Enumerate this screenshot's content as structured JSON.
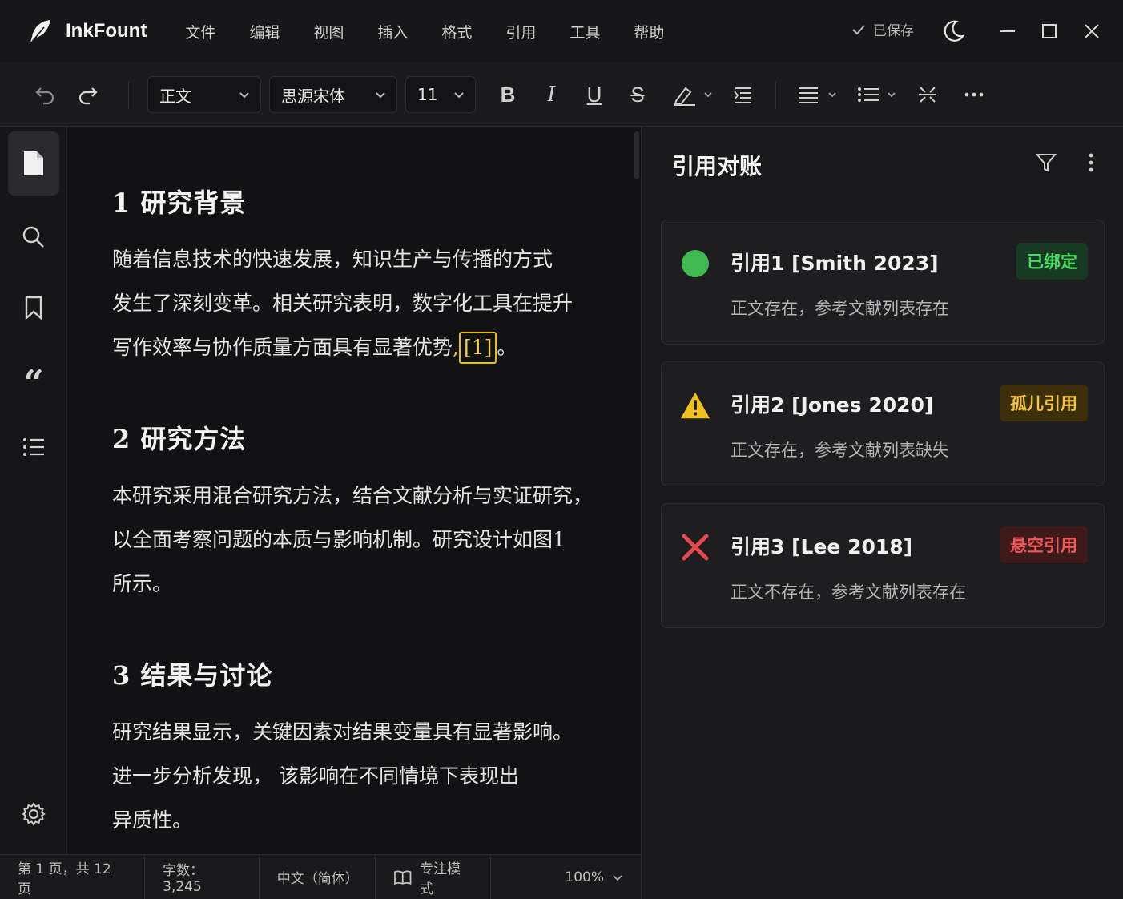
{
  "app": {
    "name": "InkFount",
    "logo": "feather-icon"
  },
  "menu": [
    "文件",
    "编辑",
    "视图",
    "插入",
    "格式",
    "引用",
    "工具",
    "帮助"
  ],
  "save_status": "已保存",
  "toolbar": {
    "style": "正文",
    "font": "思源宋体",
    "size": "11"
  },
  "document": {
    "sections": [
      {
        "heading": "1 研究背景",
        "lines": [
          "随着信息技术的快速发展，知识生产与传播的方式",
          "发生了深刻变革。相关研究表明，数字化工具在提升"
        ],
        "last_line_before_cite": "写作效率与协作质量方面具有显著优势",
        "cite": "[1]",
        "last_line_after_cite": "。"
      },
      {
        "heading": "2 研究方法",
        "lines": [
          "本研究采用混合研究方法，结合文献分析与实证研究，",
          "以全面考察问题的本质与影响机制。研究设计如图1",
          "所示。"
        ]
      },
      {
        "heading": "3 结果与讨论",
        "lines": [
          "研究结果显示，关键因素对结果变量具有显著影响。",
          "进一步分析发现， 该影响在不同情境下表现出",
          "异质性。"
        ]
      }
    ]
  },
  "status_bar": {
    "page": "第 1 页，共 12 页",
    "words": "字数：3,245",
    "language": "中文（简体）",
    "focus": "专注模式",
    "zoom": "100%"
  },
  "panel": {
    "title": "引用对账",
    "cards": [
      {
        "title": "引用1 [Smith 2023]",
        "desc": "正文存在，参考文献列表存在",
        "badge": "已绑定",
        "status": "bound",
        "icon": "green-dot-icon",
        "color": "#3fb950",
        "badge_bg": "#163a22",
        "badge_fg": "#4cd964"
      },
      {
        "title": "引用2 [Jones 2020]",
        "desc": "正文存在，参考文献列表缺失",
        "badge": "孤儿引用",
        "status": "orphan",
        "icon": "warning-icon",
        "color": "#f0c020",
        "badge_bg": "#3d2f0a",
        "badge_fg": "#f5c542"
      },
      {
        "title": "引用3 [Lee 2018]",
        "desc": "正文不存在，参考文献列表存在",
        "badge": "悬空引用",
        "status": "dangling",
        "icon": "x-icon",
        "color": "#e5484d",
        "badge_bg": "#3e1a1b",
        "badge_fg": "#ef5a5a"
      }
    ]
  }
}
